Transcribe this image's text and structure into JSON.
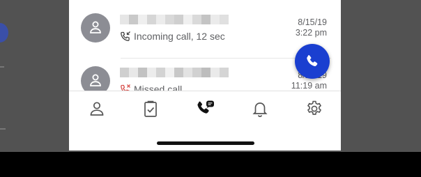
{
  "calls": [
    {
      "status": "Incoming call, 12 sec",
      "date": "8/15/19",
      "time": "3:22 pm",
      "type": "incoming",
      "icon": "incoming-call-icon"
    },
    {
      "status": "Missed call",
      "date": "8/15/19",
      "time": "11:19 am",
      "type": "missed",
      "icon": "missed-call-icon"
    }
  ],
  "fab": {
    "icon": "phone-icon",
    "color": "#1a3fd0"
  },
  "tabs": [
    {
      "icon": "contacts-icon"
    },
    {
      "icon": "tasks-clipboard-icon"
    },
    {
      "icon": "calls-icon",
      "selected": true
    },
    {
      "icon": "notifications-bell-icon"
    },
    {
      "icon": "settings-gear-icon"
    }
  ],
  "colors": {
    "accent": "#1a3fd0",
    "missed": "#d9534f",
    "avatar": "#8c8d94"
  }
}
